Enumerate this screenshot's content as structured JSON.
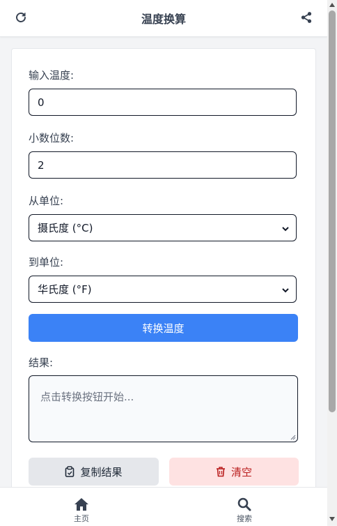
{
  "header": {
    "title": "温度换算",
    "refresh_icon": "refresh-icon",
    "share_icon": "share-icon"
  },
  "form": {
    "input_label": "输入温度:",
    "input_value": "0",
    "decimals_label": "小数位数:",
    "decimals_value": "2",
    "from_label": "从单位:",
    "from_value": "摄氏度 (°C)",
    "to_label": "到单位:",
    "to_value": "华氏度 (°F)",
    "convert_button": "转换温度",
    "result_label": "结果:",
    "result_placeholder": "点击转换按钮开始...",
    "copy_button": "复制结果",
    "clear_button": "清空"
  },
  "nav": {
    "home_label": "主页",
    "search_label": "搜索"
  },
  "colors": {
    "primary": "#3b82f6",
    "danger_bg": "#fee2e2",
    "danger_text": "#b91c1c"
  }
}
